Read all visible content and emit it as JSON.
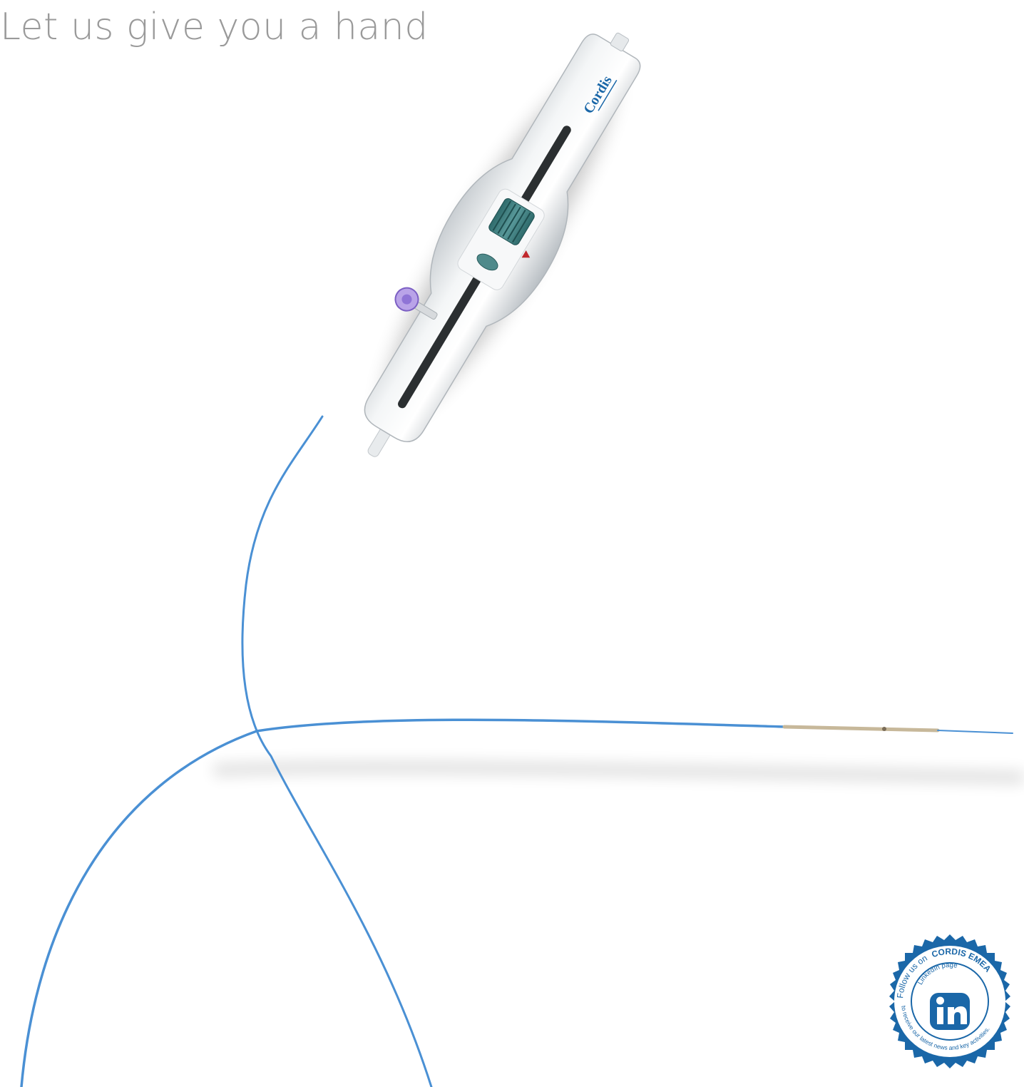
{
  "headline": {
    "text": "Let us give you a hand"
  },
  "product": {
    "brand_label": "Cordis",
    "device_icon": "steerable-catheter-handle",
    "catheter_color": "#4a90d4"
  },
  "linkedin_badge": {
    "icon": "linkedin-icon",
    "arc_text_top": "Follow us on",
    "arc_text_brand": "CORDIS EMEA",
    "inner_text": "LinkedIn page",
    "arc_text_bottom": "to receive our latest news and key activities.",
    "badge_color": "#1a67a8"
  },
  "colors": {
    "headline": "#9a9a9a",
    "brand_blue": "#1a67a8",
    "accent_purple": "#9b7fd6",
    "knob_teal": "#3f7f80"
  }
}
